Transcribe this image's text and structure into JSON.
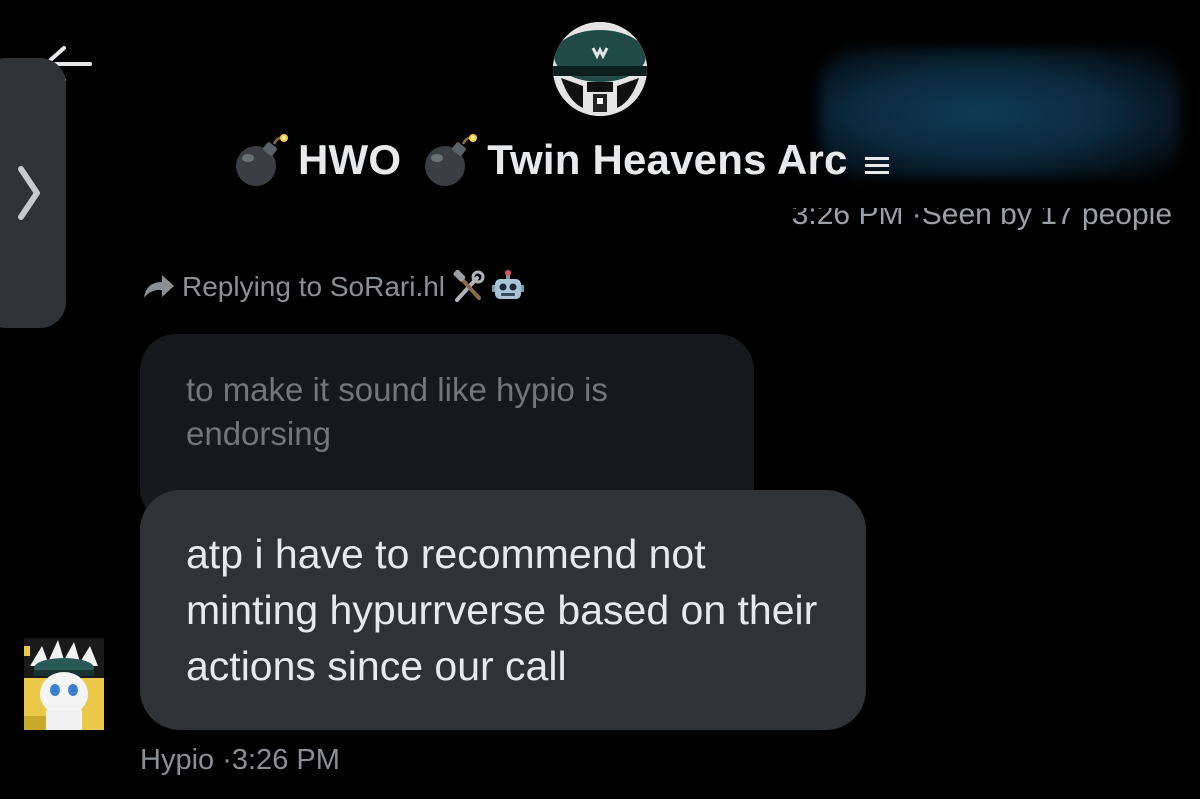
{
  "header": {
    "title_part1": "HWO",
    "title_part2": "Twin Heavens Arc",
    "seen_time": "3:26 PM",
    "seen_text": "·Seen by 17 people"
  },
  "icons": {
    "back": "back-arrow-icon",
    "bomb": "bomb-emoji-icon",
    "menu": "menu-lines-icon",
    "side_handle": "chevron-right-icon",
    "reply": "reply-arrow-icon",
    "tools": "hammer-and-wrench-emoji-icon",
    "robot": "robot-emoji-icon"
  },
  "reply": {
    "label": "Replying to SoRari.hl"
  },
  "quoted_message": {
    "text": "to make it sound like hypio is endorsing"
  },
  "message": {
    "text": "atp i have to recommend not minting hypurrverse based on their actions since our call",
    "sender": "Hypio",
    "time": "·3:26 PM"
  },
  "colors": {
    "background": "#000000",
    "bubble_main": "#2f3336",
    "bubble_quoted": "#16181c",
    "text_primary": "#e7e9ea",
    "text_secondary": "#8b9095"
  }
}
